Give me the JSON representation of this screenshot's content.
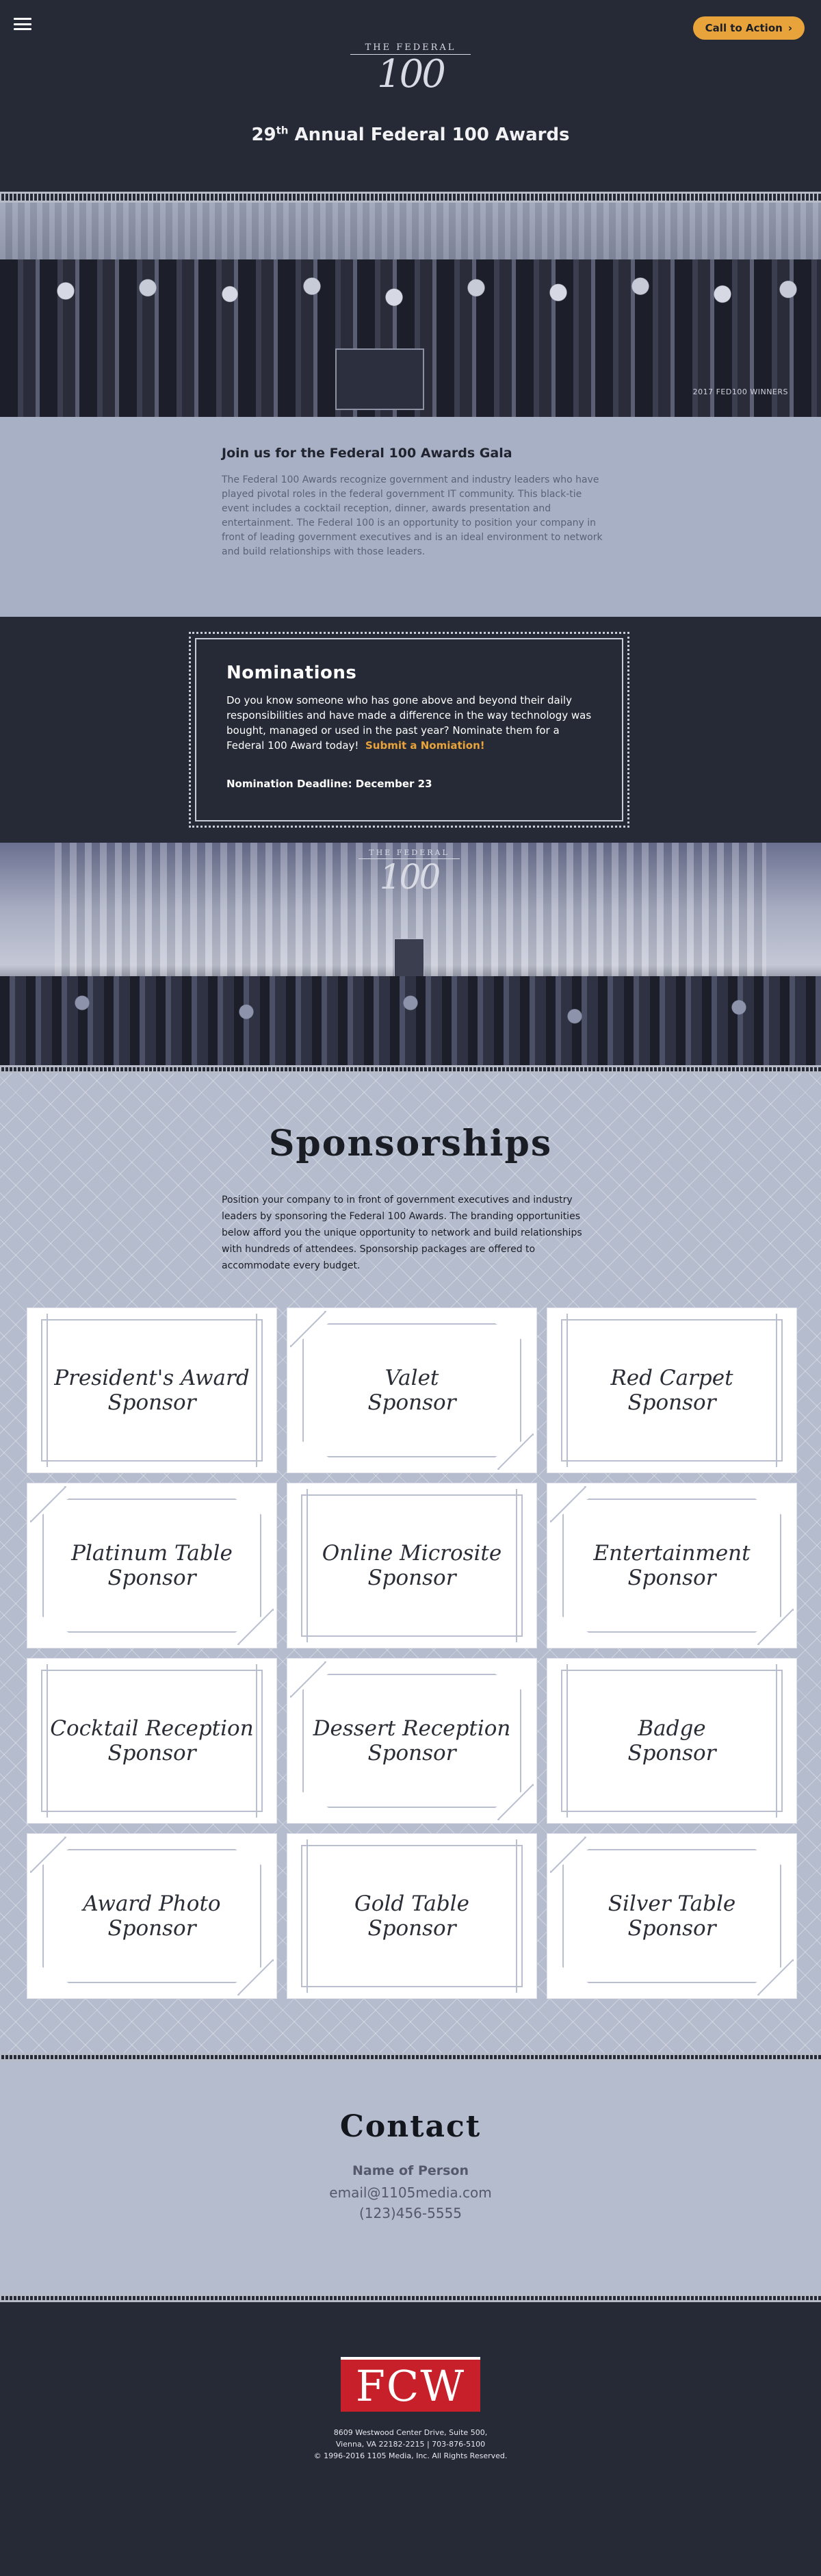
{
  "header": {
    "cta_label": "Call to Action",
    "cta_arrow": "›",
    "logo_top": "THE FEDERAL",
    "logo_num": "100",
    "title_prefix": "29",
    "title_sup": "th",
    "title_rest": " Annual Federal 100 Awards"
  },
  "hero": {
    "caption": "2017 FED100 WINNERS"
  },
  "gala": {
    "title": "Join us for the Federal 100 Awards Gala",
    "body": "The Federal 100 Awards recognize government and industry leaders who have played pivotal roles in the federal government IT community. This black-tie event includes a cocktail reception, dinner, awards presentation and entertainment. The Federal 100 is an opportunity to position your company in front of leading government executives and is an ideal environment to network and build relationships with those leaders."
  },
  "nominations": {
    "title": "Nominations",
    "body": "Do you know someone who has gone above and beyond their daily responsibilities and have made a difference in the way technology was bought, managed or used in the past year? Nominate them for a Federal 100 Award today!",
    "link_label": "Submit a Nomiation!",
    "deadline": "Nomination Deadline: December 23"
  },
  "stage": {
    "logo_top": "THE FEDERAL",
    "logo_num": "100"
  },
  "sponsorships": {
    "title": "Sponsorships",
    "body": "Position your company to in front of government executives and industry leaders by sponsoring the Federal 100 Awards. The branding opportunities below afford you the unique opportunity to network and build relationships with hundreds of attendees. Sponsorship packages are offered to accommodate every budget.",
    "cards": [
      {
        "line1": "President's Award",
        "line2": "Sponsor"
      },
      {
        "line1": "Valet",
        "line2": "Sponsor"
      },
      {
        "line1": "Red Carpet",
        "line2": "Sponsor"
      },
      {
        "line1": "Platinum Table",
        "line2": "Sponsor"
      },
      {
        "line1": "Online Microsite",
        "line2": "Sponsor"
      },
      {
        "line1": "Entertainment",
        "line2": "Sponsor"
      },
      {
        "line1": "Cocktail Reception",
        "line2": "Sponsor"
      },
      {
        "line1": "Dessert Reception",
        "line2": "Sponsor"
      },
      {
        "line1": "Badge",
        "line2": "Sponsor"
      },
      {
        "line1": "Award Photo",
        "line2": "Sponsor"
      },
      {
        "line1": "Gold Table",
        "line2": "Sponsor"
      },
      {
        "line1": "Silver Table",
        "line2": "Sponsor"
      }
    ]
  },
  "contact": {
    "title": "Contact",
    "name": "Name of Person",
    "email": "email@1105media.com",
    "phone": "(123)456-5555"
  },
  "footer": {
    "logo_text": "FCW",
    "address1": "8609 Westwood Center Drive, Suite 500,",
    "address2": "Vienna, VA 22182-2215  |  703-876-5100",
    "copyright": "© 1996-2016 1105 Media, Inc. All Rights Reserved."
  },
  "colors": {
    "navy": "#262a36",
    "accent": "#e8a33b",
    "slate": "#a8b0c6",
    "fcw_red": "#c8202a"
  }
}
